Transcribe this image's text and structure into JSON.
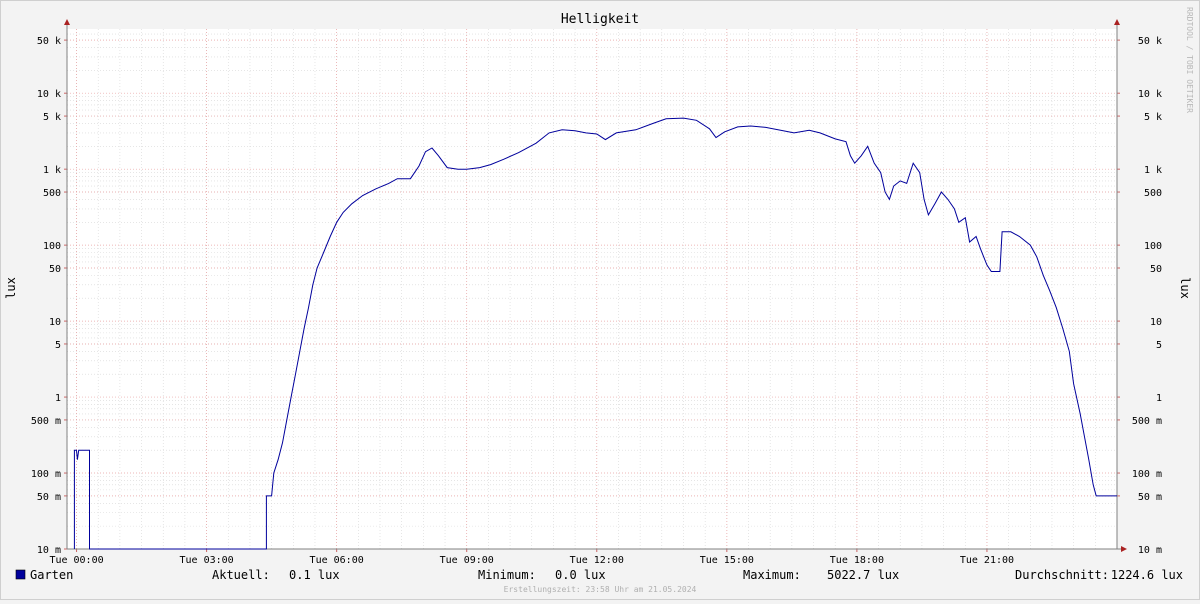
{
  "chart_data": {
    "type": "line",
    "title": "Helligkeit",
    "ylabel": "lux",
    "ylabel_right": "lux",
    "y_scale": "log",
    "ylim": [
      0.01,
      70000
    ],
    "y_ticks": [
      {
        "v": 50000,
        "label": "50 k"
      },
      {
        "v": 10000,
        "label": "10 k"
      },
      {
        "v": 5000,
        "label": "5 k"
      },
      {
        "v": 1000,
        "label": "1 k"
      },
      {
        "v": 500,
        "label": "500"
      },
      {
        "v": 100,
        "label": "100"
      },
      {
        "v": 50,
        "label": "50"
      },
      {
        "v": 10,
        "label": "10"
      },
      {
        "v": 5,
        "label": "5"
      },
      {
        "v": 1,
        "label": "1"
      },
      {
        "v": 0.5,
        "label": "500 m"
      },
      {
        "v": 0.1,
        "label": "100 m"
      },
      {
        "v": 0.05,
        "label": "50 m"
      },
      {
        "v": 0.01,
        "label": "10 m"
      }
    ],
    "xlim": [
      -0.22,
      24
    ],
    "x_unit": "hours since 00:00",
    "x_ticks": [
      {
        "v": 0,
        "label": "Tue 00:00"
      },
      {
        "v": 3,
        "label": "Tue 03:00"
      },
      {
        "v": 6,
        "label": "Tue 06:00"
      },
      {
        "v": 9,
        "label": "Tue 09:00"
      },
      {
        "v": 12,
        "label": "Tue 12:00"
      },
      {
        "v": 15,
        "label": "Tue 15:00"
      },
      {
        "v": 18,
        "label": "Tue 18:00"
      },
      {
        "v": 21,
        "label": "Tue 21:00"
      }
    ],
    "grid": true,
    "series": [
      {
        "name": "Garten",
        "color": "#00009c",
        "points": [
          [
            -0.05,
            0.01
          ],
          [
            -0.05,
            0.2
          ],
          [
            0.0,
            0.2
          ],
          [
            0.02,
            0.15
          ],
          [
            0.05,
            0.2
          ],
          [
            0.3,
            0.2
          ],
          [
            0.3,
            0.01
          ],
          [
            4.38,
            0.01
          ],
          [
            4.38,
            0.05
          ],
          [
            4.5,
            0.05
          ],
          [
            4.55,
            0.1
          ],
          [
            4.65,
            0.15
          ],
          [
            4.75,
            0.25
          ],
          [
            4.85,
            0.5
          ],
          [
            4.95,
            1.0
          ],
          [
            5.05,
            2.0
          ],
          [
            5.15,
            4.0
          ],
          [
            5.25,
            8.0
          ],
          [
            5.35,
            15
          ],
          [
            5.45,
            30
          ],
          [
            5.55,
            50
          ],
          [
            5.7,
            80
          ],
          [
            5.85,
            130
          ],
          [
            6.0,
            200
          ],
          [
            6.15,
            270
          ],
          [
            6.35,
            350
          ],
          [
            6.6,
            450
          ],
          [
            6.9,
            550
          ],
          [
            7.2,
            650
          ],
          [
            7.4,
            750
          ],
          [
            7.7,
            750
          ],
          [
            7.9,
            1100
          ],
          [
            8.05,
            1700
          ],
          [
            8.2,
            1900
          ],
          [
            8.35,
            1500
          ],
          [
            8.55,
            1050
          ],
          [
            8.8,
            1000
          ],
          [
            9.0,
            1000
          ],
          [
            9.3,
            1050
          ],
          [
            9.55,
            1150
          ],
          [
            9.85,
            1350
          ],
          [
            10.2,
            1650
          ],
          [
            10.6,
            2200
          ],
          [
            10.9,
            3000
          ],
          [
            11.2,
            3300
          ],
          [
            11.5,
            3200
          ],
          [
            11.75,
            3000
          ],
          [
            12.0,
            2900
          ],
          [
            12.2,
            2450
          ],
          [
            12.45,
            3000
          ],
          [
            12.9,
            3300
          ],
          [
            13.3,
            4000
          ],
          [
            13.6,
            4600
          ],
          [
            14.0,
            4700
          ],
          [
            14.3,
            4400
          ],
          [
            14.6,
            3400
          ],
          [
            14.75,
            2600
          ],
          [
            14.95,
            3100
          ],
          [
            15.25,
            3600
          ],
          [
            15.55,
            3700
          ],
          [
            15.9,
            3550
          ],
          [
            16.3,
            3200
          ],
          [
            16.55,
            3000
          ],
          [
            16.9,
            3250
          ],
          [
            17.15,
            3000
          ],
          [
            17.5,
            2500
          ],
          [
            17.75,
            2300
          ],
          [
            17.85,
            1500
          ],
          [
            17.95,
            1200
          ],
          [
            18.1,
            1500
          ],
          [
            18.25,
            2000
          ],
          [
            18.4,
            1200
          ],
          [
            18.55,
            900
          ],
          [
            18.65,
            500
          ],
          [
            18.75,
            400
          ],
          [
            18.85,
            600
          ],
          [
            19.0,
            700
          ],
          [
            19.15,
            650
          ],
          [
            19.3,
            1200
          ],
          [
            19.45,
            900
          ],
          [
            19.55,
            400
          ],
          [
            19.65,
            250
          ],
          [
            19.8,
            350
          ],
          [
            19.95,
            500
          ],
          [
            20.1,
            400
          ],
          [
            20.25,
            300
          ],
          [
            20.35,
            200
          ],
          [
            20.5,
            230
          ],
          [
            20.6,
            110
          ],
          [
            20.75,
            130
          ],
          [
            20.85,
            90
          ],
          [
            21.0,
            55
          ],
          [
            21.1,
            45
          ],
          [
            21.2,
            45
          ],
          [
            21.3,
            45
          ],
          [
            21.35,
            150
          ],
          [
            21.55,
            150
          ],
          [
            21.75,
            130
          ],
          [
            22.0,
            100
          ],
          [
            22.15,
            70
          ],
          [
            22.3,
            40
          ],
          [
            22.45,
            25
          ],
          [
            22.6,
            15
          ],
          [
            22.75,
            8
          ],
          [
            22.9,
            4
          ],
          [
            23.0,
            1.5
          ],
          [
            23.15,
            0.6
          ],
          [
            23.25,
            0.3
          ],
          [
            23.35,
            0.15
          ],
          [
            23.45,
            0.07
          ],
          [
            23.52,
            0.05
          ],
          [
            24.0,
            0.05
          ]
        ]
      }
    ]
  },
  "watermark": "RRDTOOL / TOBI OETIKER",
  "legend": {
    "series_name": "Garten",
    "series_color": "#00009c",
    "current_label": "Aktuell:",
    "current_value": "0.1 lux",
    "min_label": "Minimum:",
    "min_value": "0.0 lux",
    "max_label": "Maximum:",
    "max_value": "5022.7 lux",
    "avg_label": "Durchschnitt:",
    "avg_value": "1224.6 lux"
  },
  "footer": "Erstellungszeit: 23:58 Uhr am 21.05.2024"
}
